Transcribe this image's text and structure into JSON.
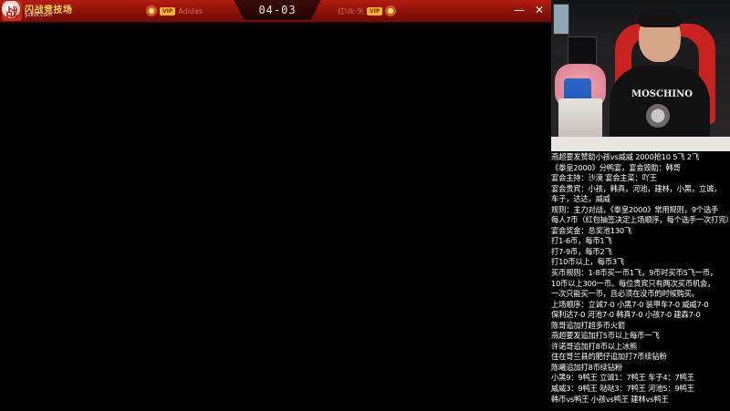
{
  "titlebar": {
    "logo_text": "闪战竞技场",
    "logo_sub": "yzkof.com",
    "left_player": {
      "vip": "VIP",
      "name": "Adidas"
    },
    "score": "04-03",
    "right_player": {
      "vip": "VIP",
      "name": "红Uk·天"
    },
    "minimize_glyph": "—",
    "close_glyph": "✕"
  },
  "webcam": {
    "shirt_text": "MOSCHINO"
  },
  "info_lines": [
    "燕超要发赞助小孩vs威威 2000抢10 5飞 2飞",
    "《拳皇2000》分鸭宴，宴会毁助：韩哥",
    "宴会主持：沙漠   宴会主菜：吖王",
    "宴会贵宾：小孩，韩真，河池，建林，小黑，立诚，",
    "车子，达达，威威",
    "规则：主力对战，《拳皇2000》常用规则，9个选手",
    "每人7币（红包抽签决定上场顺序，每个选手一次打完）",
    "宴会奖金：总奖池130飞",
    "打1-6币，每币1飞",
    "打7-9币，每币2飞",
    "打10币以上，每币3飞",
    "买币规则：1-8币买一币1飞，9币时买币5飞一币，",
    "10币以上300一币。每位贵宾只有两次买币机会，",
    "一次只能买一币，且必须在没币的时候购买。",
    "上场顺序：立诚7-0  小黑7-0  装甲车7-0  威威7-0",
    "保利达7-0  河池7-0  韩真7-0  小孩7-0  建森7-0",
    "陈哥追加打超多币火箭",
    "燕超要发追加打5币以上每币一飞",
    "许诺哥追加打8币以上冰熊",
    "住在哥兰县的肥仔追加打7币续钻粉",
    "陈曦追加打8币续钻粉",
    "小黑9：9鸭王  立诚1：7鸭王  车子4：7鸭王",
    "威威3：9鸭王  哒哒3：7鸭王  河池5：9鸭王",
    "韩币vs鸭王  小孩vs鸭王  建林vs鸭王"
  ],
  "colors": {
    "titlebar_red": "#b51d12",
    "score_text": "#f5e6d5",
    "panel_text": "#ffffff"
  }
}
